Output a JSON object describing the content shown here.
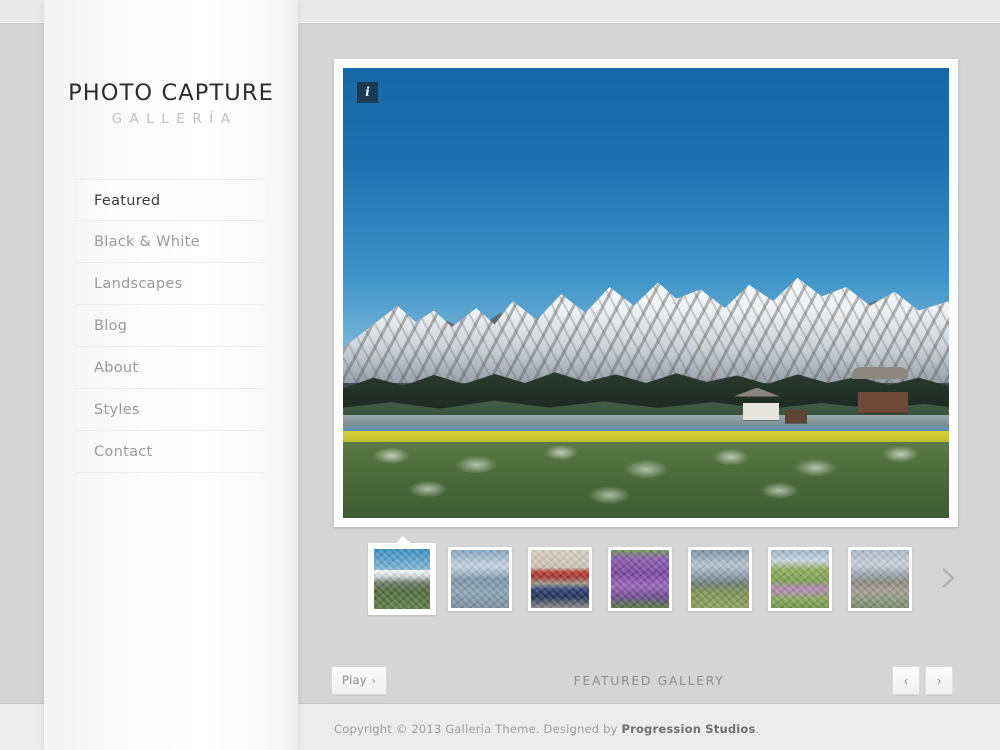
{
  "site": {
    "brand_main": "PHOTO CAPTURE",
    "brand_sub": "GALLERÍA"
  },
  "sidebar": {
    "items": [
      {
        "label": "Featured",
        "active": true
      },
      {
        "label": "Black & White",
        "active": false
      },
      {
        "label": "Landscapes",
        "active": false
      },
      {
        "label": "Blog",
        "active": false
      },
      {
        "label": "About",
        "active": false
      },
      {
        "label": "Styles",
        "active": false
      },
      {
        "label": "Contact",
        "active": false
      }
    ]
  },
  "gallery": {
    "title": "FEATURED GALLERY",
    "info_icon": "i",
    "main_image_alt": "Snow-capped Grand Teton mountains above a sagebrush field with barns",
    "thumbnails": [
      {
        "name": "teton-mountains",
        "active": true
      },
      {
        "name": "lake-clouds",
        "active": false
      },
      {
        "name": "street-red-awning-blue-car",
        "active": false
      },
      {
        "name": "purple-flowers",
        "active": false
      },
      {
        "name": "plains-storm",
        "active": false
      },
      {
        "name": "wildflower-meadow",
        "active": false
      },
      {
        "name": "bare-trees-snow",
        "active": false
      }
    ],
    "thumb_next_icon": "›",
    "controls": {
      "play_label": "Play",
      "play_chevron": "›",
      "prev_label": "‹",
      "next_label": "›"
    }
  },
  "footer": {
    "copyright_prefix": "Copyright © 2013 Galleria Theme. Designed by ",
    "designer": "Progression Studios",
    "copyright_suffix": "."
  },
  "colors": {
    "page_bg": "#d5d5d5",
    "sidebar_bg": "#ffffff",
    "accent_text": "#3b3b3b",
    "muted_text": "#9a9a9a"
  }
}
